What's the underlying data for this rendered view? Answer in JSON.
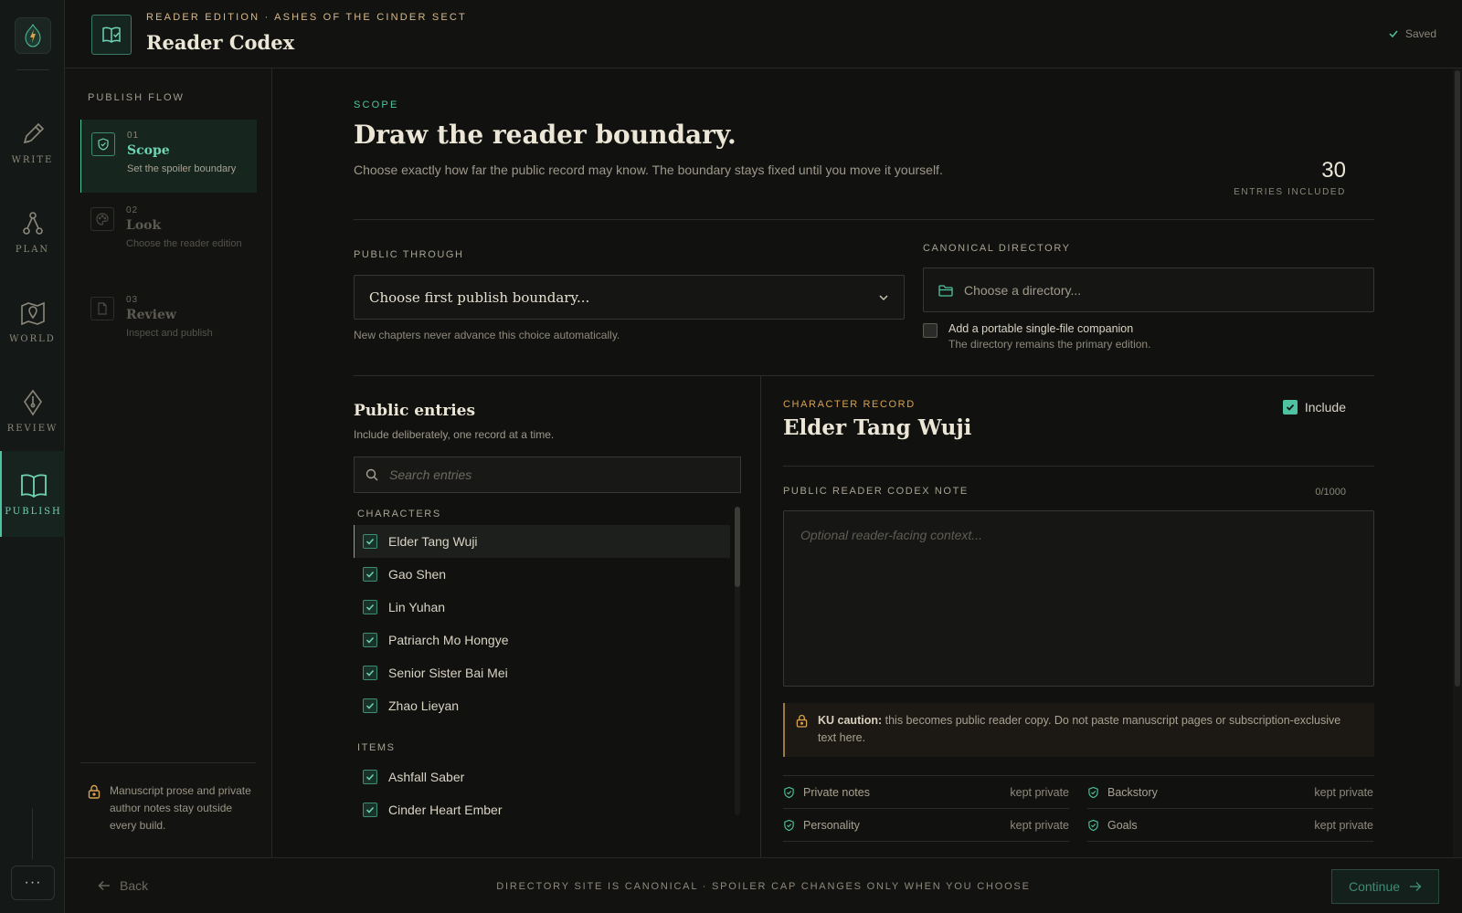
{
  "colors": {
    "accent": "#4fc3a1",
    "gold": "#d8b88b",
    "amber": "#d8a24f",
    "bg": "#111210"
  },
  "rail": {
    "logo_icon": "flame-gem-icon",
    "items": [
      {
        "label": "WRITE",
        "icon": "pen-icon"
      },
      {
        "label": "PLAN",
        "icon": "network-icon"
      },
      {
        "label": "WORLD",
        "icon": "map-pin-icon"
      },
      {
        "label": "REVIEW",
        "icon": "quill-nib-icon"
      },
      {
        "label": "PUBLISH",
        "icon": "open-book-icon",
        "active": true
      }
    ],
    "more_label": "···"
  },
  "header": {
    "eyebrow": "READER EDITION · ASHES OF THE CINDER SECT",
    "title": "Reader Codex",
    "saved": "Saved"
  },
  "flow": {
    "title": "PUBLISH FLOW",
    "steps": [
      {
        "num": "01",
        "name": "Scope",
        "desc": "Set the spoiler boundary",
        "icon": "shield-check-icon",
        "active": true
      },
      {
        "num": "02",
        "name": "Look",
        "desc": "Choose the reader edition",
        "icon": "palette-icon"
      },
      {
        "num": "03",
        "name": "Review",
        "desc": "Inspect and publish",
        "icon": "document-icon"
      }
    ],
    "private_note": "Manuscript prose and private author notes stay outside every build."
  },
  "scope": {
    "eyebrow": "SCOPE",
    "title": "Draw the reader boundary.",
    "description": "Choose exactly how far the public record may know. The boundary stays fixed until you move it yourself.",
    "count": "30",
    "count_label": "ENTRIES INCLUDED"
  },
  "boundary": {
    "label": "PUBLIC THROUGH",
    "value": "Choose first publish boundary...",
    "helper": "New chapters never advance this choice automatically."
  },
  "directory": {
    "label": "CANONICAL DIRECTORY",
    "placeholder": "Choose a directory...",
    "companion_label": "Add a portable single-file companion",
    "companion_help": "The directory remains the primary edition."
  },
  "entries": {
    "title": "Public entries",
    "subtitle": "Include deliberately, one record at a time.",
    "search_placeholder": "Search entries",
    "characters_label": "CHARACTERS",
    "characters": [
      "Elder Tang Wuji",
      "Gao Shen",
      "Lin Yuhan",
      "Patriarch Mo Hongye",
      "Senior Sister Bai Mei",
      "Zhao Lieyan"
    ],
    "items_label": "ITEMS",
    "items": [
      "Ashfall Saber",
      "Cinder Heart Ember"
    ]
  },
  "record": {
    "eyebrow": "CHARACTER RECORD",
    "name": "Elder Tang Wuji",
    "include_label": "Include",
    "note_label": "PUBLIC READER CODEX NOTE",
    "note_count": "0/1000",
    "note_placeholder": "Optional reader-facing context...",
    "caution_bold": "KU caution:",
    "caution_text": " this becomes public reader copy. Do not paste manuscript pages or subscription-exclusive text here.",
    "private_fields": [
      {
        "name": "Private notes",
        "status": "kept private"
      },
      {
        "name": "Backstory",
        "status": "kept private"
      },
      {
        "name": "Personality",
        "status": "kept private"
      },
      {
        "name": "Goals",
        "status": "kept private"
      }
    ]
  },
  "footer": {
    "back": "Back",
    "center": "DIRECTORY SITE IS CANONICAL · SPOILER CAP CHANGES ONLY WHEN YOU CHOOSE",
    "continue": "Continue"
  }
}
